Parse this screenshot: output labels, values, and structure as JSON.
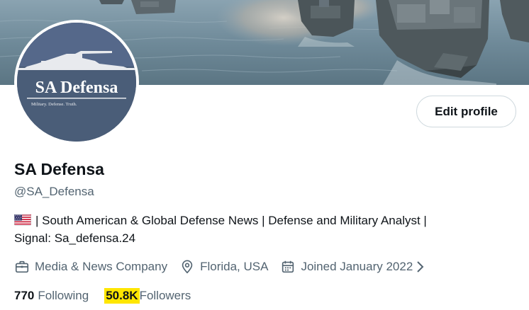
{
  "profile": {
    "display_name": "SA Defensa",
    "handle": "@SA_Defensa",
    "bio_line1": "| South American & Global Defense News | Defense and Military Analyst |",
    "bio_line2": "Signal: Sa_defensa.24",
    "avatar_title": "SA Defensa",
    "avatar_subtitle": "Military. Defense. Truth."
  },
  "actions": {
    "edit_profile_label": "Edit profile"
  },
  "meta": {
    "category": "Media & News Company",
    "location": "Florida, USA",
    "joined": "Joined January 2022"
  },
  "stats": {
    "following_count": "770",
    "following_label": "Following",
    "followers_count": "50.8K",
    "followers_label": "Followers"
  },
  "icons": [
    "flag-us-icon",
    "briefcase-icon",
    "location-pin-icon",
    "calendar-icon",
    "chevron-right-icon"
  ],
  "colors": {
    "text_primary": "#0f1419",
    "text_secondary": "#536471",
    "border": "#cfd9de",
    "highlight": "#ffe600",
    "avatar_bg": "#4a5d78"
  }
}
